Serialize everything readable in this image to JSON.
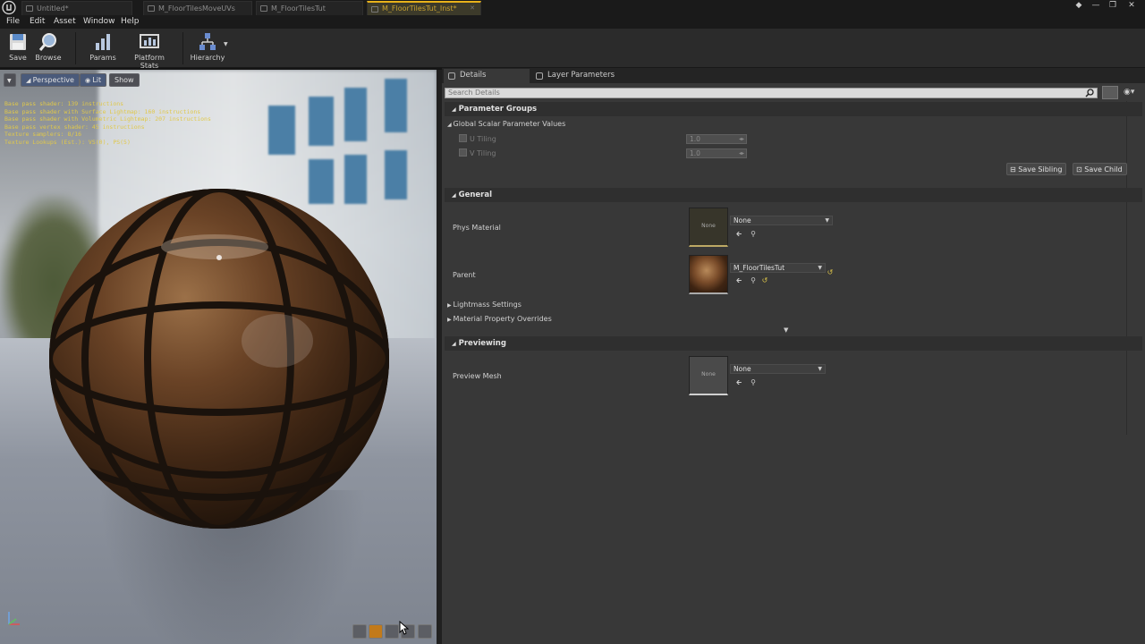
{
  "titlebar": {
    "tabs": [
      {
        "label": "Untitled*"
      },
      {
        "label": "M_FloorTilesMoveUVs"
      },
      {
        "label": "M_FloorTilesTut"
      },
      {
        "label": "M_FloorTilesTut_Inst*"
      }
    ],
    "active_tab_index": 3
  },
  "menu": {
    "items": [
      "File",
      "Edit",
      "Asset",
      "Window",
      "Help"
    ]
  },
  "toolbar": {
    "save_label": "Save",
    "browse_label": "Browse",
    "params_label": "Params",
    "platform_stats_label": "Platform Stats",
    "hierarchy_label": "Hierarchy"
  },
  "viewport": {
    "perspective_label": "Perspective",
    "lit_label": "Lit",
    "show_label": "Show",
    "stats": [
      "Base pass shader: 139 instructions",
      "Base pass shader with Surface Lightmap: 160 instructions",
      "Base pass shader with Volumetric Lightmap: 207 instructions",
      "Base pass vertex shader: 45 instructions",
      "Texture samplers: 8/16",
      "Texture Lookups (Est.): VS(0), PS(5)"
    ]
  },
  "panel": {
    "tabs": [
      "Details",
      "Layer Parameters"
    ],
    "search_placeholder": "Search Details",
    "parameter_groups": {
      "title": "Parameter Groups",
      "subgroup": "Global Scalar Parameter Values",
      "params": [
        {
          "label": "U Tiling",
          "value": "1.0"
        },
        {
          "label": "V Tiling",
          "value": "1.0"
        }
      ],
      "save_sibling": "Save Sibling",
      "save_child": "Save Child"
    },
    "general": {
      "title": "General",
      "phys_material_label": "Phys Material",
      "phys_material_value": "None",
      "phys_thumb_text": "None",
      "parent_label": "Parent",
      "parent_value": "M_FloorTilesTut",
      "lightmass_label": "Lightmass Settings",
      "material_overrides_label": "Material Property Overrides"
    },
    "previewing": {
      "title": "Previewing",
      "preview_mesh_label": "Preview Mesh",
      "preview_mesh_value": "None",
      "preview_thumb_text": "None"
    }
  },
  "colors": {
    "accent": "#e8b21a",
    "stats_text": "#e0c84a",
    "panel_bg": "#383838"
  }
}
